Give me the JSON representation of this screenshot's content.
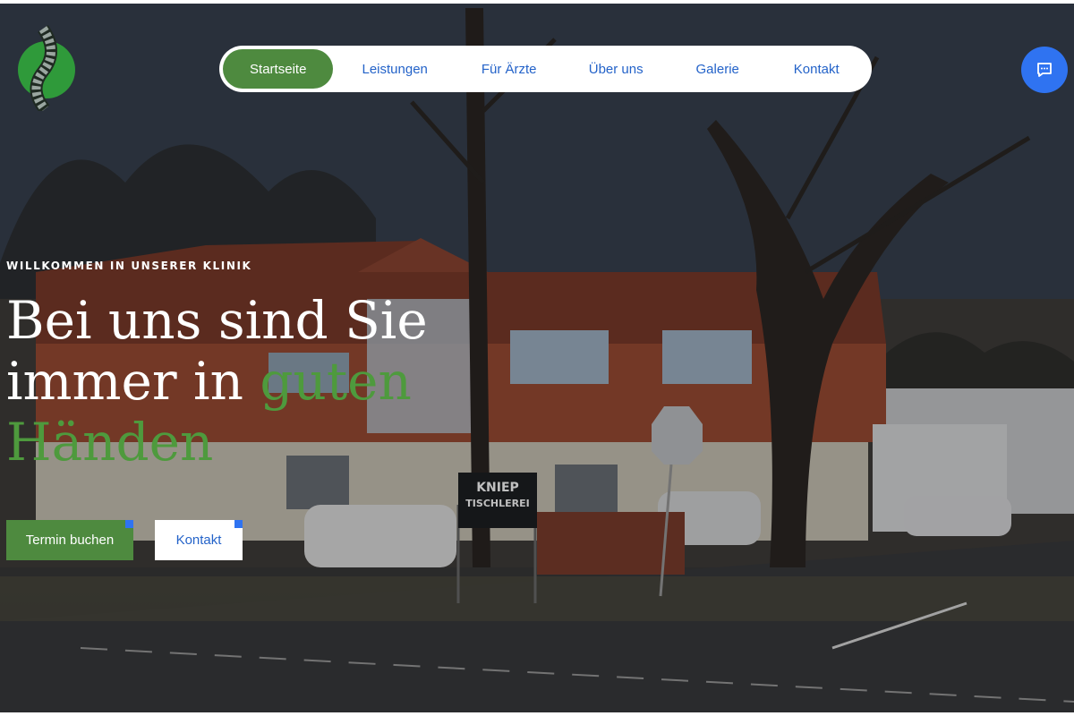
{
  "nav": {
    "items": [
      {
        "label": "Startseite",
        "active": true
      },
      {
        "label": "Leistungen",
        "active": false
      },
      {
        "label": "Für Ärzte",
        "active": false
      },
      {
        "label": "Über uns",
        "active": false
      },
      {
        "label": "Galerie",
        "active": false
      },
      {
        "label": "Kontakt",
        "active": false
      }
    ]
  },
  "hero": {
    "kicker": "WILLKOMMEN IN UNSERER KLINIK",
    "headline_part1": "Bei uns sind Sie immer in ",
    "headline_part2": "guten Händen",
    "primary_button": "Termin buchen",
    "secondary_button": "Kontakt"
  },
  "scene": {
    "sign_line1": "KNIEP",
    "sign_line2": "TISCHLEREI"
  },
  "colors": {
    "accent_green": "#4e8a3f",
    "link_blue": "#2463c9",
    "chat_blue": "#2f73f1"
  },
  "icons": {
    "logo": "spine-logo",
    "chat": "chat-bubble-icon"
  }
}
